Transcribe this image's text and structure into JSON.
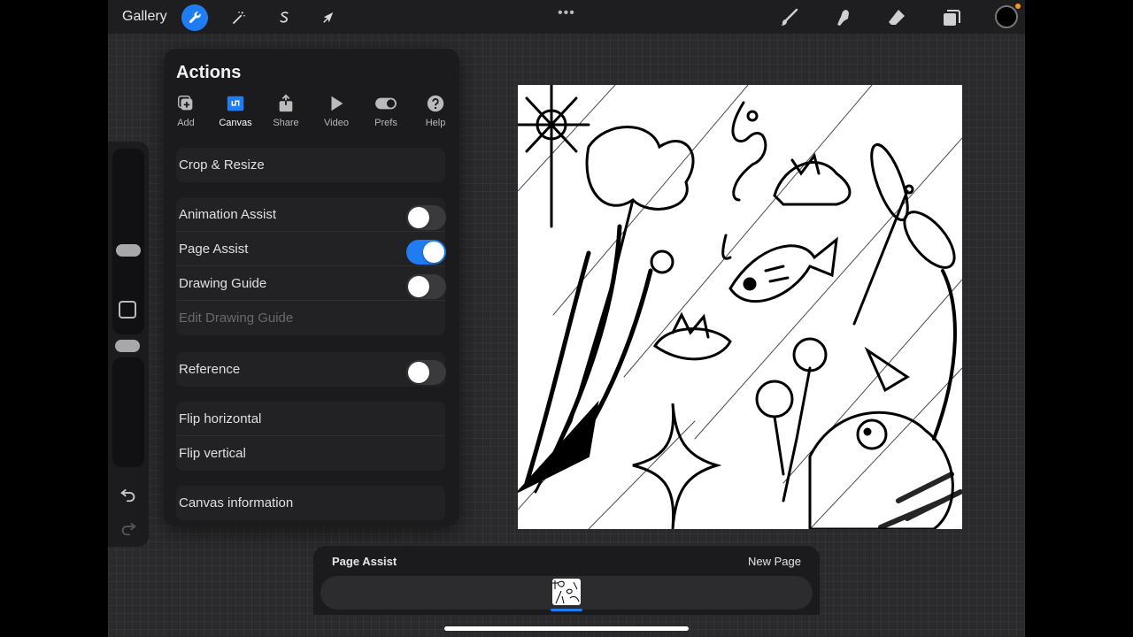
{
  "topbar": {
    "gallery_label": "Gallery",
    "more_label": "•••",
    "tools": [
      {
        "name": "actions",
        "icon": "wrench-icon",
        "active": true
      },
      {
        "name": "adjustments",
        "icon": "magic-wand-icon"
      },
      {
        "name": "selection",
        "icon": "selection-s-icon"
      },
      {
        "name": "transform",
        "icon": "arrow-cursor-icon"
      }
    ],
    "right_tools": [
      "brush-icon",
      "smudge-icon",
      "eraser-icon",
      "layers-icon",
      "color-icon"
    ],
    "accent_color": "#1f7cf3",
    "current_color": "#000000"
  },
  "actions": {
    "title": "Actions",
    "tabs": [
      {
        "label": "Add",
        "icon": "add-image-icon"
      },
      {
        "label": "Canvas",
        "icon": "canvas-icon",
        "active": true
      },
      {
        "label": "Share",
        "icon": "share-icon"
      },
      {
        "label": "Video",
        "icon": "play-icon"
      },
      {
        "label": "Prefs",
        "icon": "toggle-icon"
      },
      {
        "label": "Help",
        "icon": "question-icon"
      }
    ],
    "crop_resize": "Crop & Resize",
    "animation_assist": {
      "label": "Animation Assist",
      "on": false
    },
    "page_assist": {
      "label": "Page Assist",
      "on": true
    },
    "drawing_guide": {
      "label": "Drawing Guide",
      "on": false
    },
    "edit_drawing_guide": "Edit Drawing Guide",
    "reference": {
      "label": "Reference",
      "on": false
    },
    "flip_horizontal": "Flip horizontal",
    "flip_vertical": "Flip vertical",
    "canvas_information": "Canvas information"
  },
  "page_assist_bar": {
    "title": "Page Assist",
    "new_page": "New Page"
  }
}
